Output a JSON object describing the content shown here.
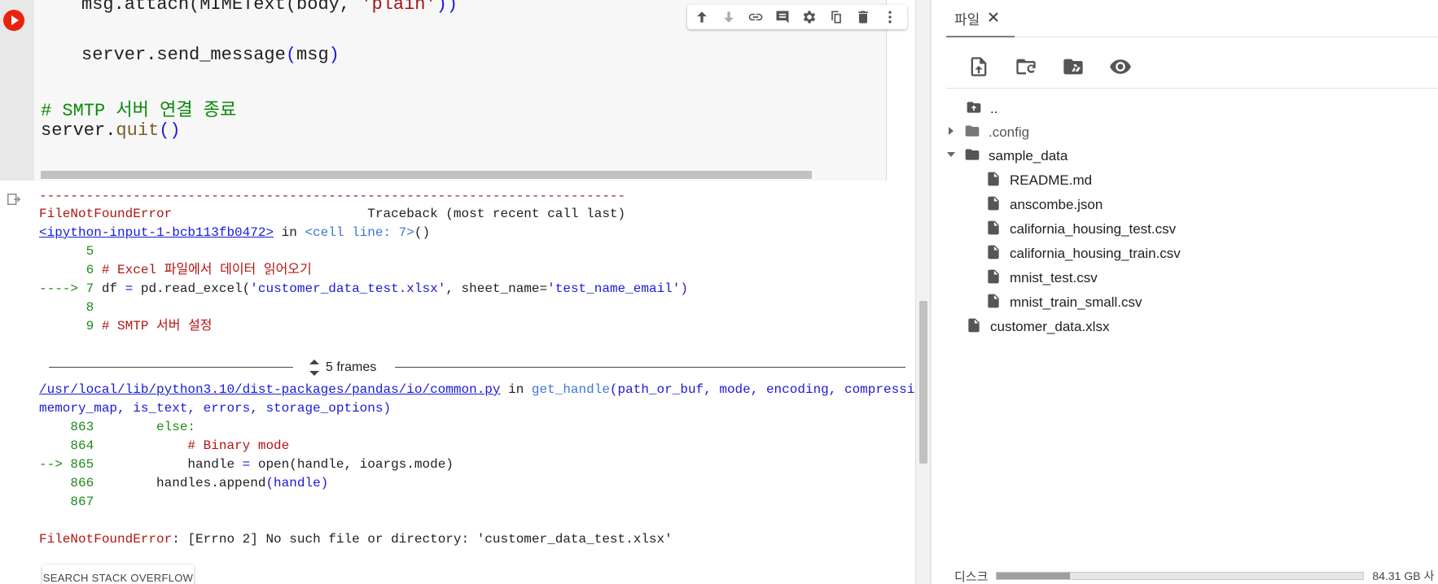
{
  "code": {
    "line1_prefix": "msg.attach(MIMEText(body, ",
    "line1_str": "'plain'",
    "line1_suffix": "))",
    "line2_fn": "server.send_message",
    "line2_paren_open": "(",
    "line2_arg": "msg",
    "line2_paren_close": ")",
    "line3_comment": "# SMTP 서버 연결 종료",
    "line4_obj": "server.",
    "line4_fn": "quit",
    "line4_parens": "()"
  },
  "cell_toolbar": {
    "icons": [
      "arrow-up-icon",
      "arrow-down-icon",
      "link-icon",
      "comment-icon",
      "gear-icon",
      "mirror-icon",
      "trash-icon",
      "more-icon"
    ]
  },
  "output": {
    "dashes": "---------------------------------------------------------------------------",
    "error_name": "FileNotFoundError",
    "traceback_header": "                         Traceback (most recent call last)",
    "input_link": "<ipython-input-1-bcb113fb0472>",
    "in_word": " in ",
    "cell_line": "<cell line: 7>",
    "cell_line_parens": "()",
    "l5_num": "      5",
    "l6_num": "      6 ",
    "l6_comment": "# Excel 파일에서 데이터 읽어오기",
    "l7_arrow": "----> 7 ",
    "l7_code_a": "df ",
    "l7_eq": "=",
    "l7_code_b": " pd.read_excel(",
    "l7_str1": "'customer_data_test.xlsx'",
    "l7_code_c": ", sheet_name=",
    "l7_str2": "'test_name_email'",
    "l7_close": ")",
    "l8_num": "      8",
    "l9_num": "      9 ",
    "l9_comment": "# SMTP 서버 설정",
    "frames_label": "5 frames",
    "common_link": "/usr/local/lib/python3.10/dist-packages/pandas/io/common.py",
    "get_handle": "get_handle",
    "get_handle_args1": "(path_or_buf, mode, encoding, compression,",
    "get_handle_args2": "memory_map, is_text, errors, storage_options)",
    "l863_num": "    863 ",
    "l863_code": "       else:",
    "l864_num": "    864 ",
    "l864_code": "           # Binary mode",
    "l865_arrow": "--> 865 ",
    "l865_code_a": "           handle ",
    "l865_eq": "=",
    "l865_code_b": " open(handle, ioargs.mode)",
    "l866_num": "    866 ",
    "l866_code_a": "       handles.append",
    "l866_code_b": "(handle)",
    "l867_num": "    867",
    "final_error_name": "FileNotFoundError",
    "final_error_msg": ": [Errno 2] No such file or directory: 'customer_data_test.xlsx'",
    "stack_overflow_label": "SEARCH STACK OVERFLOW"
  },
  "file_panel": {
    "tab_label": "파일",
    "actions": [
      "upload-icon",
      "refresh-folder-icon",
      "drive-icon",
      "eye-icon"
    ],
    "tree": [
      {
        "name": "..",
        "type": "parent"
      },
      {
        "name": ".config",
        "type": "folder",
        "collapsed": true
      },
      {
        "name": "sample_data",
        "type": "folder",
        "collapsed": false
      },
      {
        "name": "README.md",
        "type": "file"
      },
      {
        "name": "anscombe.json",
        "type": "file"
      },
      {
        "name": "california_housing_test.csv",
        "type": "file"
      },
      {
        "name": "california_housing_train.csv",
        "type": "file"
      },
      {
        "name": "mnist_test.csv",
        "type": "file"
      },
      {
        "name": "mnist_train_small.csv",
        "type": "file"
      },
      {
        "name": "customer_data.xlsx",
        "type": "file"
      }
    ],
    "disk_label": "디스크",
    "disk_text": "84.31 GB 사",
    "disk_used_fraction": 0.2
  }
}
